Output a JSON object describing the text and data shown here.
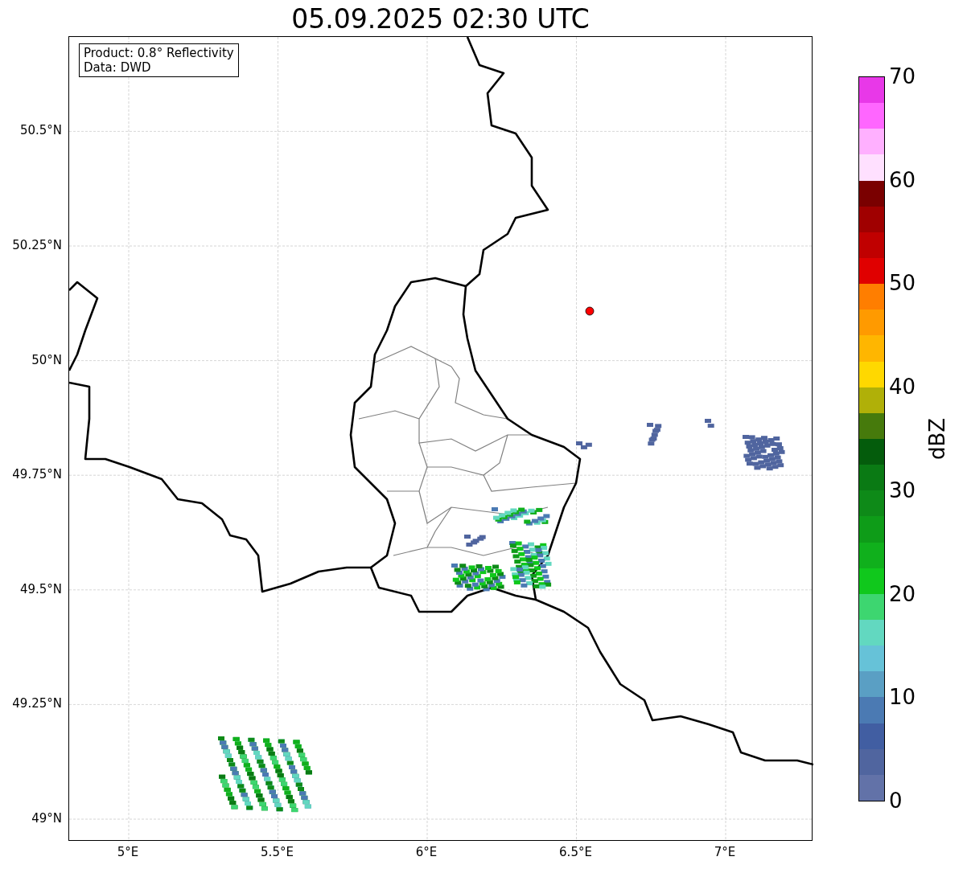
{
  "title": "05.09.2025 02:30 UTC",
  "legend": [
    "Product: 0.8° Reflectivity",
    "Data: DWD"
  ],
  "lat_ticks": [
    "50.5°N",
    "50.25°N",
    "50°N",
    "49.75°N",
    "49.5°N",
    "49.25°N",
    "49°N"
  ],
  "lon_ticks": [
    "5°E",
    "5.5°E",
    "6°E",
    "6.5°E",
    "7°E"
  ],
  "colorbar": {
    "label": "dBZ",
    "ticks": [
      "70",
      "60",
      "50",
      "40",
      "30",
      "20",
      "10",
      "0"
    ],
    "bins": [
      {
        "color": "#e838e8"
      },
      {
        "color": "#ff66ff"
      },
      {
        "color": "#ffb0ff"
      },
      {
        "color": "#ffe0ff"
      },
      {
        "color": "#7a0000"
      },
      {
        "color": "#a00000"
      },
      {
        "color": "#c00000"
      },
      {
        "color": "#e00000"
      },
      {
        "color": "#ff7e00"
      },
      {
        "color": "#ff9a00"
      },
      {
        "color": "#ffb600"
      },
      {
        "color": "#ffd800"
      },
      {
        "color": "#b0b008"
      },
      {
        "color": "#467a0c"
      },
      {
        "color": "#045c0c"
      },
      {
        "color": "#0a7a14"
      },
      {
        "color": "#0e8a18"
      },
      {
        "color": "#0e9c18"
      },
      {
        "color": "#10b01c"
      },
      {
        "color": "#10c81c"
      },
      {
        "color": "#3dd670"
      },
      {
        "color": "#62d8c0"
      },
      {
        "color": "#66c2d8"
      },
      {
        "color": "#5a9fc4"
      },
      {
        "color": "#4b7ab3"
      },
      {
        "color": "#415ea2"
      },
      {
        "color": "#50659f"
      },
      {
        "color": "#6272a8"
      }
    ]
  }
}
